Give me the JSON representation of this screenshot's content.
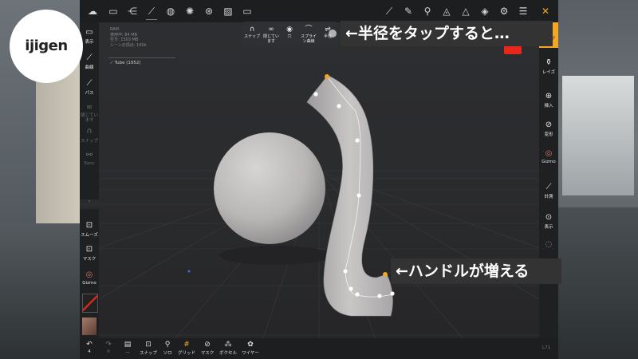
{
  "watermark": {
    "logo": "ijigen"
  },
  "callouts": {
    "radius": "←半径をタップすると…",
    "handles": "←ハンドルが増える"
  },
  "topbar": {
    "icons": [
      "menu-icon",
      "folder-icon",
      "share-icon",
      "globe-icon",
      "sun-icon",
      "film-reel-icon",
      "image-icon",
      "video-icon",
      "curve-tool-icon",
      "brush-icon",
      "dropper-icon",
      "layers-plane-icon",
      "triangle-icon",
      "layers-icon",
      "gear-icon",
      "sliders-icon",
      "tools-icon"
    ]
  },
  "stats": {
    "ram": "RAM",
    "used": "使用中: 84 MB",
    "free": "空き: 1503 MB",
    "vertices": "シーンの頂点: 100k",
    "object": "Tube (1952)"
  },
  "left_tools": {
    "items": [
      {
        "label": "表示",
        "active": true
      },
      {
        "label": "曲線",
        "active": true
      },
      {
        "label": "パス",
        "active": true
      },
      {
        "label": "閉じています",
        "active": false
      },
      {
        "label": "スナップ",
        "active": false
      },
      {
        "label": "Sync",
        "active": false
      }
    ]
  },
  "left_tools_bottom": {
    "items": [
      {
        "label": "スムーズ"
      },
      {
        "label": "マスク"
      },
      {
        "label": "Gizmo"
      }
    ]
  },
  "popup": {
    "items": [
      {
        "label": "スナップ"
      },
      {
        "label": "閉じています"
      },
      {
        "label": "穴"
      },
      {
        "label": "スプライン曲線"
      },
      {
        "label": "半径"
      }
    ]
  },
  "right_tools": {
    "top_label": "ループ",
    "items": [
      {
        "label": "レイズ"
      },
      {
        "label": "挿入"
      },
      {
        "label": "変形"
      },
      {
        "label": "Gizmo"
      },
      {
        "label": "計測"
      },
      {
        "label": "表示"
      }
    ]
  },
  "bottombar": {
    "undo_count": "4",
    "redo_count": "0",
    "items": [
      {
        "label": "..."
      },
      {
        "label": "スナップ"
      },
      {
        "label": "ソロ"
      },
      {
        "label": "グリッド"
      },
      {
        "label": "マスク"
      },
      {
        "label": "ボクセル"
      },
      {
        "label": "ワイヤー"
      }
    ],
    "right_text": "L71"
  },
  "colors": {
    "accent": "#f5a623",
    "active_swatch": "#e8261c",
    "panel": "#1f2022",
    "viewport": "#2b2c2f"
  }
}
